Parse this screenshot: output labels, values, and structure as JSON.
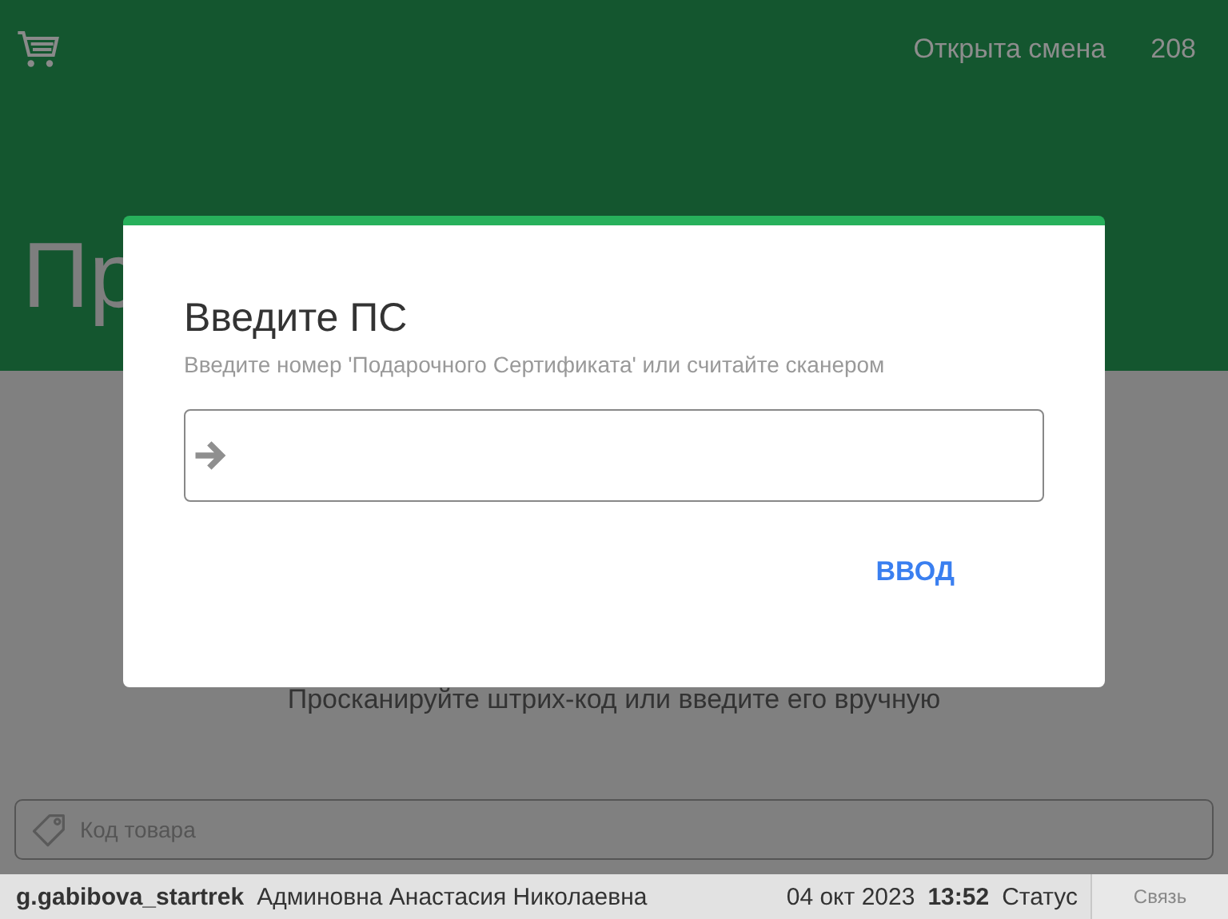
{
  "header": {
    "shift_status": "Открыта смена",
    "shift_number": "208",
    "page_title": "Пр"
  },
  "main": {
    "hint": "Просканируйте штрих-код или введите его вручную",
    "code_field": {
      "placeholder": "Код товара"
    }
  },
  "dialog": {
    "title": "Введите ПС",
    "subtitle": "Введите номер 'Подарочного Сертификата' или считайте сканером",
    "button": "ВВОД"
  },
  "status_bar": {
    "login": "g.gabibova_startrek",
    "user": "Админовна Анастасия Николаевна",
    "date": "04 окт 2023",
    "time": "13:52",
    "status": "Статус",
    "link": "Связь"
  }
}
